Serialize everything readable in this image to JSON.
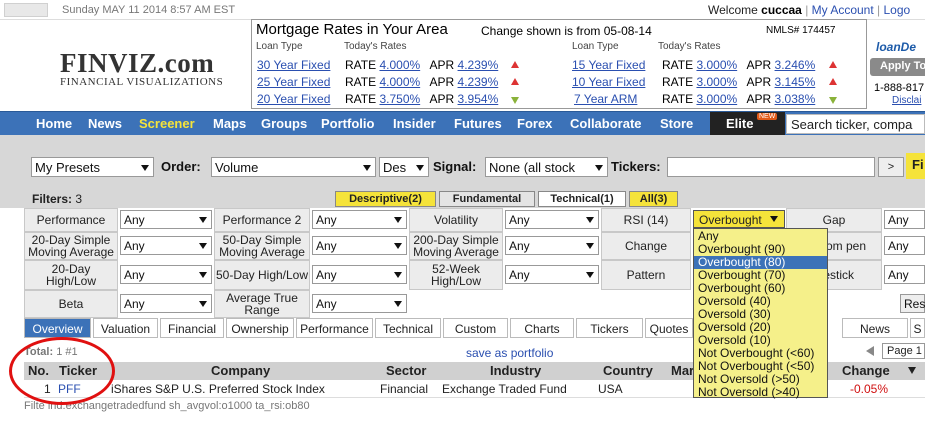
{
  "header": {
    "date": "Sunday MAY 11 2014 8:57 AM EST",
    "welcome_prefix": "Welcome",
    "username": "cuccaa",
    "my_account": "My Account",
    "logout": "Logo"
  },
  "logo": {
    "main": "FINVIZ.com",
    "sub": "FINANCIAL VISUALIZATIONS"
  },
  "rates": {
    "title": "Mortgage Rates in Your Area",
    "change_note": "Change shown is from 05-08-14",
    "nmls": "NMLS# 174457",
    "col_loan_type": "Loan Type",
    "col_todays_rates": "Today's Rates",
    "rate_label": "RATE",
    "apr_label": "APR",
    "left": [
      {
        "type": "30 Year Fixed",
        "rate": "4.000%",
        "apr": "4.239%",
        "dir": "up"
      },
      {
        "type": "25 Year Fixed",
        "rate": "4.000%",
        "apr": "4.239%",
        "dir": "up"
      },
      {
        "type": "20 Year Fixed",
        "rate": "3.750%",
        "apr": "3.954%",
        "dir": "down"
      }
    ],
    "right": [
      {
        "type": "15 Year Fixed",
        "rate": "3.000%",
        "apr": "3.246%",
        "dir": "up"
      },
      {
        "type": "10 Year Fixed",
        "rate": "3.000%",
        "apr": "3.145%",
        "dir": "up"
      },
      {
        "type": "7 Year ARM",
        "rate": "3.000%",
        "apr": "3.038%",
        "dir": "down"
      }
    ]
  },
  "ad": {
    "logo": "loanDe",
    "button": "Apply To",
    "phone": "1-888-817",
    "disclaimer": "Disclai"
  },
  "nav": {
    "items": [
      "Home",
      "News",
      "Screener",
      "Maps",
      "Groups",
      "Portfolio",
      "Insider",
      "Futures",
      "Forex",
      "Collaborate",
      "Store"
    ],
    "selected": "Screener",
    "elite": "Elite",
    "elite_badge": "NEW",
    "search_placeholder": "Search ticker, compa"
  },
  "controls": {
    "presets": "My Presets",
    "order_label": "Order:",
    "order_value": "Volume",
    "direction": "Des",
    "signal_label": "Signal:",
    "signal_value": "None (all stock",
    "tickers_label": "Tickers:",
    "go": ">",
    "find": "Fi"
  },
  "filters": {
    "label": "Filters:",
    "count": "3",
    "tabs": [
      "Descriptive(2)",
      "Fundamental",
      "Technical(1)",
      "All(3)"
    ]
  },
  "grid": {
    "r1": [
      "Performance",
      "Any",
      "Performance 2",
      "Any",
      "Volatility",
      "Any",
      "RSI (14)",
      "Overbought",
      "Gap",
      "Any"
    ],
    "r2": [
      "20-Day Simple Moving Average",
      "Any",
      "50-Day Simple Moving Average",
      "Any",
      "200-Day Simple Moving Average",
      "Any",
      "Change",
      "ge from pen",
      "Any"
    ],
    "r3": [
      "20-Day High/Low",
      "Any",
      "50-Day High/Low",
      "Any",
      "52-Week High/Low",
      "Any",
      "Pattern",
      "dlestick",
      "Any"
    ],
    "r4": [
      "Beta",
      "Any",
      "Average True Range",
      "Any",
      "Res"
    ]
  },
  "rsi_dropdown": {
    "options": [
      "Any",
      "Overbought (90)",
      "Overbought (80)",
      "Overbought (70)",
      "Overbought (60)",
      "Oversold (40)",
      "Oversold (30)",
      "Oversold (20)",
      "Oversold (10)",
      "Not Overbought (<60)",
      "Not Overbought (<50)",
      "Not Oversold (>50)",
      "Not Oversold (>40)"
    ],
    "highlighted": "Overbought (80)"
  },
  "view_tabs": [
    "Overview",
    "Valuation",
    "Financial",
    "Ownership",
    "Performance",
    "Technical",
    "Custom",
    "Charts",
    "Tickers",
    "Quotes",
    "News",
    "S"
  ],
  "results": {
    "total_label": "Total:",
    "total_value": "1 #1",
    "save_portfolio": "save as portfolio",
    "page": "Page 1",
    "headers": [
      "No.",
      "Ticker",
      "Company",
      "Sector",
      "Industry",
      "Country",
      "Mar",
      "Change"
    ],
    "row": {
      "no": "1",
      "ticker": "PFF",
      "company": "iShares S&P U.S. Preferred Stock Index",
      "sector": "Financial",
      "industry": "Exchange Traded Fund",
      "country": "USA",
      "change": "-0.05%"
    }
  },
  "filter_string": "Filte ind:exchangetradedfund sh_avgvol:o1000 ta_rsi:ob80",
  "colors": {
    "nav": "#3c72b8",
    "accent_yellow": "#f5e33a",
    "link": "#2a4fb0",
    "circle": "#e01010"
  }
}
